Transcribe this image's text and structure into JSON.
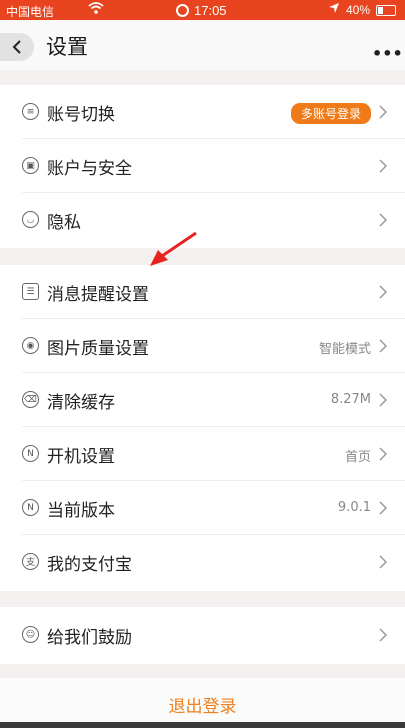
{
  "status_bar": {
    "carrier": "中国电信",
    "time": "17:05",
    "battery": "40%"
  },
  "navbar": {
    "title": "设置",
    "more": "•••"
  },
  "groups": [
    {
      "items": [
        {
          "label": "账号切换",
          "badge": "多账号登录"
        },
        {
          "label": "账户与安全"
        },
        {
          "label": "隐私"
        }
      ]
    },
    {
      "items": [
        {
          "label": "消息提醒设置"
        },
        {
          "label": "图片质量设置",
          "value": "智能模式"
        },
        {
          "label": "清除缓存",
          "value": "8.27M"
        },
        {
          "label": "开机设置",
          "value": "首页"
        },
        {
          "label": "当前版本",
          "value": "9.0.1"
        },
        {
          "label": "我的支付宝"
        }
      ]
    },
    {
      "items": [
        {
          "label": "给我们鼓励"
        }
      ]
    }
  ],
  "logout": {
    "label": "退出登录"
  },
  "icons": [
    "switch-account-icon",
    "lock-icon",
    "privacy-eye-icon",
    "message-settings-icon",
    "image-quality-icon",
    "clear-cache-icon",
    "startup-icon",
    "version-icon",
    "alipay-icon",
    "encourage-icon"
  ],
  "colors": {
    "accent": "#ef7a1a",
    "status_bar": "#e8441f",
    "logout_text": "#f08020"
  }
}
